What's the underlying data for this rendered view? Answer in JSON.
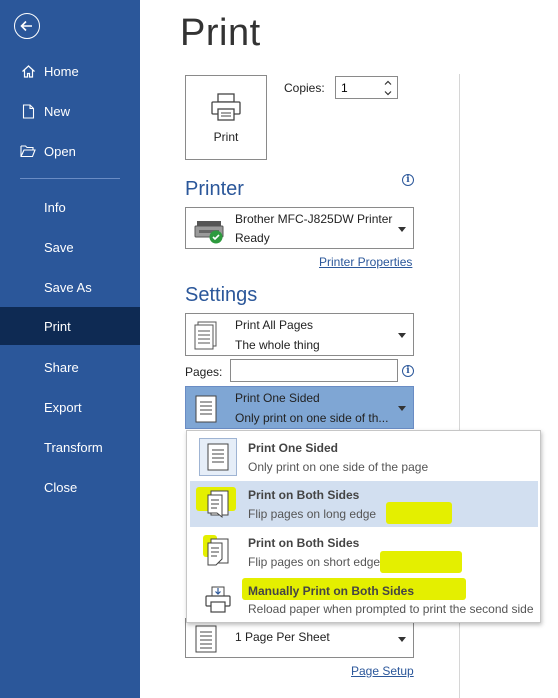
{
  "sidebar": {
    "back_icon": "back-arrow-icon",
    "items": [
      {
        "label": "Home",
        "icon": "home-icon"
      },
      {
        "label": "New",
        "icon": "new-document-icon"
      },
      {
        "label": "Open",
        "icon": "folder-open-icon"
      },
      {
        "label": "Info"
      },
      {
        "label": "Save"
      },
      {
        "label": "Save As"
      },
      {
        "label": "Print",
        "active": true
      },
      {
        "label": "Share"
      },
      {
        "label": "Export"
      },
      {
        "label": "Transform"
      },
      {
        "label": "Close"
      }
    ]
  },
  "page": {
    "title": "Print",
    "print_button": "Print",
    "copies_label": "Copies:",
    "copies_value": "1"
  },
  "printer": {
    "heading": "Printer",
    "name": "Brother MFC-J825DW Printer",
    "status": "Ready",
    "properties_link": "Printer Properties"
  },
  "settings": {
    "heading": "Settings",
    "print_range": {
      "line1": "Print All Pages",
      "line2": "The whole thing"
    },
    "pages_label": "Pages:",
    "pages_value": "",
    "sides": {
      "line1": "Print One Sided",
      "line2": "Only print on one side of th..."
    },
    "per_sheet": {
      "line1": "1 Page Per Sheet"
    },
    "page_setup_link": "Page Setup"
  },
  "sides_menu": {
    "options": [
      {
        "title": "Print One Sided",
        "desc": "Only print on one side of the page"
      },
      {
        "title": "Print on Both Sides",
        "desc": "Flip pages on long edge",
        "highlighted": true
      },
      {
        "title": "Print on Both Sides",
        "desc": "Flip pages on short edge"
      },
      {
        "title": "Manually Print on Both Sides",
        "desc": "Reload paper when prompted to print the second side"
      }
    ]
  },
  "colors": {
    "sidebar_bg": "#2b579a",
    "sidebar_active": "#0e2a53",
    "accent": "#2b579a",
    "selected_dropdown": "#7fa6d4",
    "menu_highlight": "#d2dff0",
    "annotation_highlight": "#e4ef00"
  }
}
